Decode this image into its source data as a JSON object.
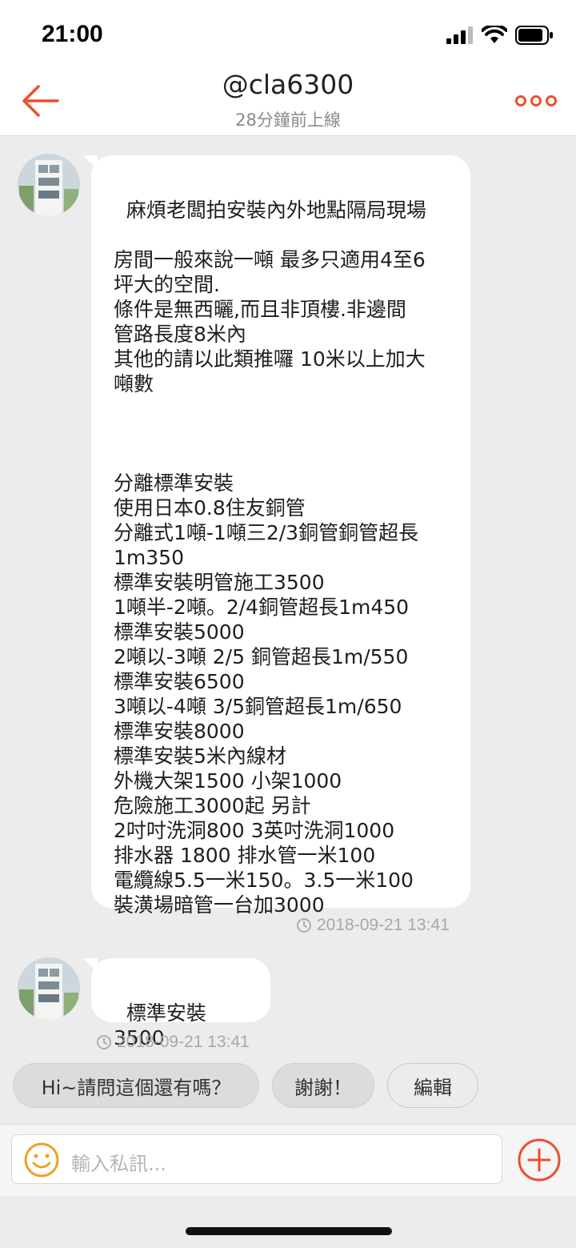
{
  "status_bar": {
    "time": "21:00"
  },
  "header": {
    "title": "@cla6300",
    "subtitle": "28分鐘前上線"
  },
  "messages": [
    {
      "text": "麻煩老闆拍安裝內外地點隔局現場\n\n房間一般來說一噸 最多只適用4至6\n坪大的空間.\n條件是無西曬,而且非頂樓.非邊間\n管路長度8米內\n其他的請以此類推囉 10米以上加大\n噸數\n\n\n\n分離標準安裝\n使用日本0.8住友銅管\n分離式1噸-1噸三2/3銅管銅管超長\n1m350\n標準安裝明管施工3500\n1噸半-2噸。2/4銅管超長1m450\n標準安裝5000\n2噸以-3噸 2/5 銅管超長1m/550\n標準安裝6500\n3噸以-4噸 3/5銅管超長1m/650\n標準安裝8000\n標準安裝5米內線材\n外機大架1500 小架1000\n危險施工3000起 另計\n2吋吋洗洞800 3英吋洗洞1000\n排水器 1800 排水管一米100\n電纜線5.5一米150。3.5一米100\n裝潢場暗管一台加3000",
      "timestamp": "2018-09-21 13:41"
    },
    {
      "text": "標準安裝3500",
      "timestamp": "2018-09-21 13:41"
    }
  ],
  "quick_replies": [
    "Hi~請問這個還有嗎？",
    "謝謝！",
    "編輯"
  ],
  "composer": {
    "placeholder": "輸入私訊..."
  },
  "colors": {
    "accent": "#ee4d2d",
    "emoji": "#f0a020"
  }
}
